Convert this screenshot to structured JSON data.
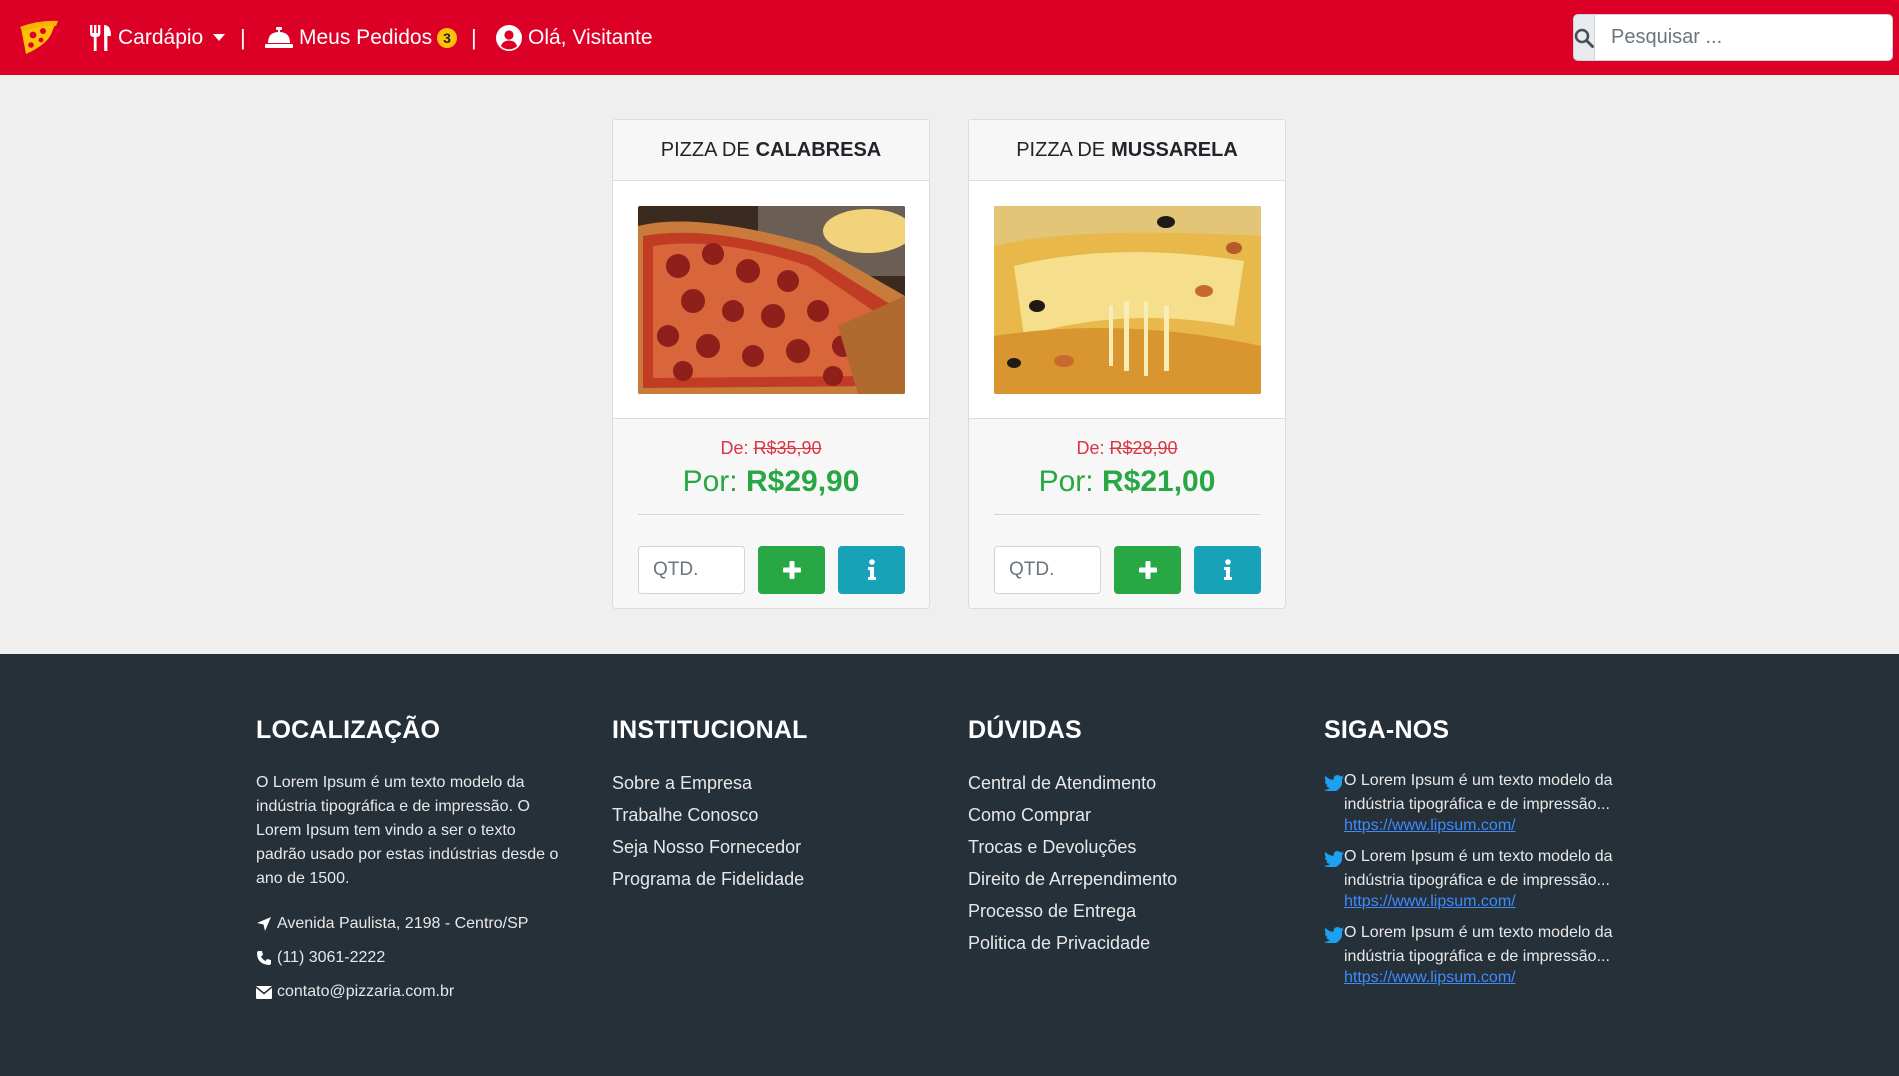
{
  "nav": {
    "menu_label": "Cardápio",
    "orders_label": "Meus Pedidos",
    "orders_count": "3",
    "separator": "|",
    "user_label": "Olá, Visitante",
    "search_placeholder": "Pesquisar ..."
  },
  "colors": {
    "navbar": "#dc0027",
    "footer": "#263038",
    "price_new": "#28a745",
    "price_old": "#dc3545",
    "add_button": "#28a745",
    "info_button": "#17a2b8",
    "badge": "#ffc107"
  },
  "products": [
    {
      "title_prefix": "PIZZA DE",
      "title_name": "CALABRESA",
      "old_label": "De:",
      "old_price": "R$35,90",
      "new_label": "Por:",
      "new_price": "R$29,90",
      "qty_placeholder": "QTD."
    },
    {
      "title_prefix": "PIZZA DE",
      "title_name": "MUSSARELA",
      "old_label": "De:",
      "old_price": "R$28,90",
      "new_label": "Por:",
      "new_price": "R$21,00",
      "qty_placeholder": "QTD."
    }
  ],
  "footer": {
    "location": {
      "title": "LOCALIZAÇÃO",
      "text": "O Lorem Ipsum é um texto modelo da indústria tipográfica e de impressão. O Lorem Ipsum tem vindo a ser o texto padrão usado por estas indústrias desde o ano de 1500.",
      "address": "Avenida Paulista, 2198 - Centro/SP",
      "phone": "(11) 3061-2222",
      "email": "contato@pizzaria.com.br"
    },
    "institutional": {
      "title": "INSTITUCIONAL",
      "links": [
        "Sobre a Empresa",
        "Trabalhe Conosco",
        "Seja Nosso Fornecedor",
        "Programa de Fidelidade"
      ]
    },
    "faq": {
      "title": "DÚVIDAS",
      "links": [
        "Central de Atendimento",
        "Como Comprar",
        "Trocas e Devoluções",
        "Direito de Arrependimento",
        "Processo de Entrega",
        "Politica de Privacidade"
      ]
    },
    "social": {
      "title": "SIGA-NOS",
      "tweets": [
        {
          "text": "O Lorem Ipsum é um texto modelo da indústria tipográfica e de impressão...",
          "link": "https://www.lipsum.com/"
        },
        {
          "text": "O Lorem Ipsum é um texto modelo da indústria tipográfica e de impressão...",
          "link": "https://www.lipsum.com/"
        },
        {
          "text": "O Lorem Ipsum é um texto modelo da indústria tipográfica e de impressão...",
          "link": "https://www.lipsum.com/"
        }
      ]
    }
  }
}
